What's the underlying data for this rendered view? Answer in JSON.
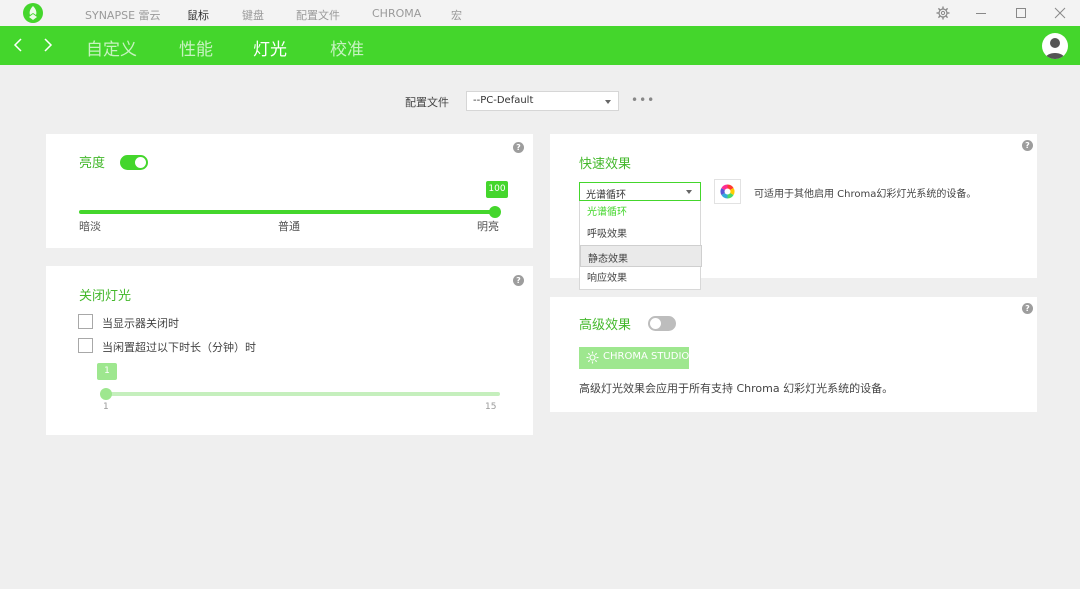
{
  "app": {
    "nav": [
      {
        "label": "SYNAPSE 雷云",
        "active": false
      },
      {
        "label": "鼠标",
        "active": true
      },
      {
        "label": "键盘",
        "active": false
      },
      {
        "label": "配置文件",
        "active": false
      },
      {
        "label": "CHROMA",
        "active": false
      },
      {
        "label": "宏",
        "active": false
      }
    ]
  },
  "subnav": {
    "tabs": [
      {
        "label": "自定义",
        "active": false
      },
      {
        "label": "性能",
        "active": false
      },
      {
        "label": "灯光",
        "active": true
      },
      {
        "label": "校准",
        "active": false
      }
    ]
  },
  "profile": {
    "label": "配置文件",
    "value": "--PC-Default",
    "more": "•••"
  },
  "brightness": {
    "title": "亮度",
    "enabled": true,
    "value": "100",
    "level_percent": 100,
    "ticks": [
      "暗淡",
      "普通",
      "明亮"
    ]
  },
  "lights_off": {
    "title": "关闭灯光",
    "options": [
      {
        "label": "当显示器关闭时",
        "checked": false
      },
      {
        "label": "当闲置超过以下时长（分钟）时",
        "checked": false
      }
    ],
    "timeout_value": "1",
    "min": "1",
    "max": "15"
  },
  "quick_effects": {
    "title": "快速效果",
    "selected": "光谱循环",
    "options": [
      {
        "label": "光谱循环",
        "state": "selected"
      },
      {
        "label": "呼吸效果",
        "state": "normal"
      },
      {
        "label": "静态效果",
        "state": "hover"
      },
      {
        "label": "响应效果",
        "state": "normal"
      }
    ],
    "description": "可适用于其他启用 Chroma幻彩灯光系统的设备。"
  },
  "advanced_effects": {
    "title": "高级效果",
    "enabled": false,
    "button_label": "CHROMA STUDIO",
    "description": "高级灯光效果会应用于所有支持 Chroma 幻彩灯光系统的设备。"
  },
  "help_glyph": "?",
  "colors": {
    "accent": "#44d62c",
    "accent_light": "#9ee78f",
    "background": "#efefef"
  }
}
